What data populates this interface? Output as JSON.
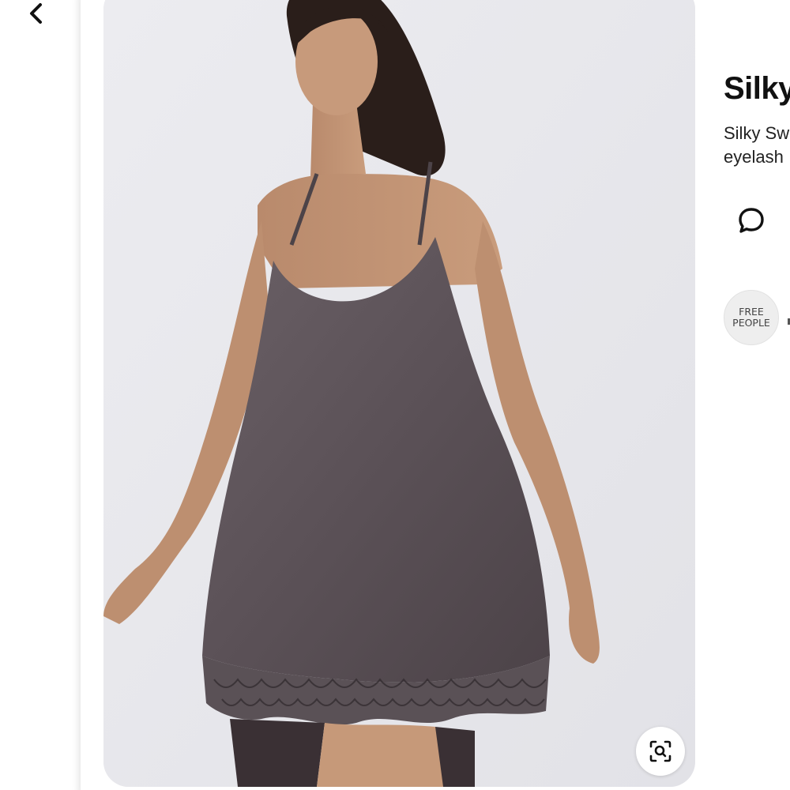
{
  "nav": {
    "back_icon": "chevron-left-icon"
  },
  "pin": {
    "image_alt": "Model wearing charcoal silky slip dress with eyelash lace hem",
    "dress_color": "#5b5157",
    "lens_icon": "visual-search-icon"
  },
  "details": {
    "title": "Silky",
    "description_line1": "Silky Sw",
    "description_line2": "eyelash"
  },
  "actions": {
    "comment_icon": "comment-icon"
  },
  "brand": {
    "line1": "FREE",
    "line2": "PEOPLE"
  }
}
